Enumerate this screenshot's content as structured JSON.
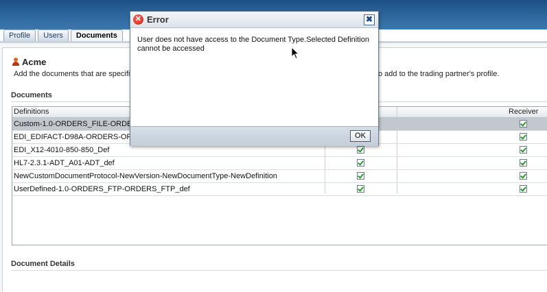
{
  "tabs": [
    {
      "label": "Profile",
      "active": false
    },
    {
      "label": "Users",
      "active": false
    },
    {
      "label": "Documents",
      "active": true
    }
  ],
  "partner": {
    "name": "Acme",
    "icon": "user-icon"
  },
  "description": {
    "left": "Add the documents that are specific",
    "right": "o add to the trading partner's profile."
  },
  "documents_section": {
    "title": "Documents"
  },
  "table": {
    "columns": {
      "definitions": "Definitions",
      "receiver": "Receiver"
    },
    "rows": [
      {
        "name": "Custom-1.0-ORDERS_FILE-ORDERS",
        "sender_checked": true,
        "receiver_checked": true,
        "selected": true
      },
      {
        "name": "EDI_EDIFACT-D98A-ORDERS-ORDE",
        "sender_checked": true,
        "receiver_checked": true,
        "selected": false
      },
      {
        "name": "EDI_X12-4010-850-850_Def",
        "sender_checked": true,
        "receiver_checked": true,
        "selected": false
      },
      {
        "name": "HL7-2.3.1-ADT_A01-ADT_def",
        "sender_checked": true,
        "receiver_checked": true,
        "selected": false
      },
      {
        "name": "NewCustomDocumentProtocol-NewVersion-NewDocumentType-NewDefinition",
        "sender_checked": true,
        "receiver_checked": true,
        "selected": false
      },
      {
        "name": "UserDefined-1.0-ORDERS_FTP-ORDERS_FTP_def",
        "sender_checked": true,
        "receiver_checked": true,
        "selected": false
      }
    ]
  },
  "details_section": {
    "title": "Document Details"
  },
  "dialog": {
    "title": "Error",
    "message": "User does not have access to the Document Type.Selected Definition cannot be accessed",
    "ok_label": "OK",
    "close_glyph": "✖",
    "icon_glyph": "✕"
  },
  "colors": {
    "accent": "#2a6298",
    "check": "#2a9a2a",
    "error": "#c51a0c"
  }
}
